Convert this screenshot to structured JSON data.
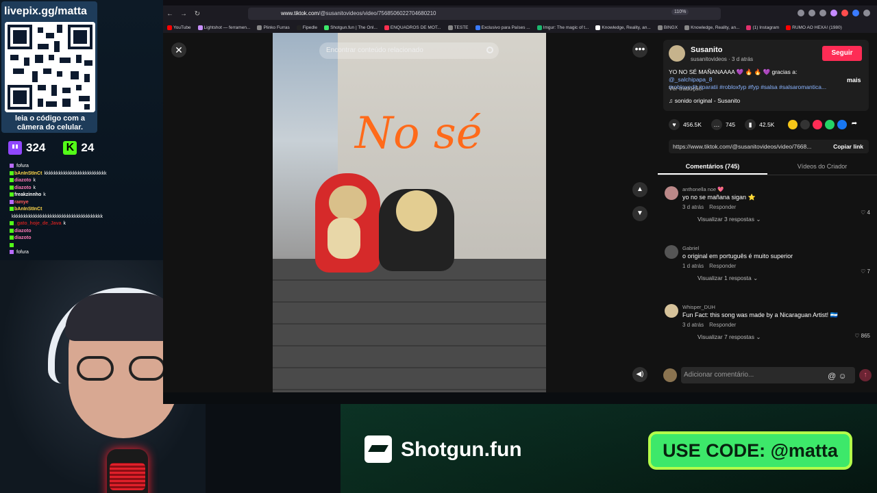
{
  "overlay": {
    "qr_title": "livepix.gg/matta",
    "qr_caption": "leia o código com a câmera do celular.",
    "twitch_count": "324",
    "kick_count": "24",
    "chat": [
      {
        "user": "",
        "msg": "fofura"
      },
      {
        "user": "bAnInStInCt",
        "msg": "kkkkkkkkkkkkkkkkkkkkkkkkkk"
      },
      {
        "user": "diazoto",
        "msg": "k"
      },
      {
        "user": "diazoto",
        "msg": "k"
      },
      {
        "user": "freakzinnho",
        "msg": "k"
      },
      {
        "user": "ramye",
        "msg": ""
      },
      {
        "user": "bAnInStInCt",
        "msg": ""
      },
      {
        "user": "",
        "msg": "kkkkkkkkkkkkkkkkkkkkkkkkkkkkkkkkkkkkkk"
      },
      {
        "user": "_gato_hoje_de_Java",
        "msg": "k"
      },
      {
        "user": "diazoto",
        "msg": ""
      },
      {
        "user": "diazoto",
        "msg": ""
      },
      {
        "user": "",
        "msg": ""
      },
      {
        "user": "",
        "msg": "fofura"
      }
    ]
  },
  "browser": {
    "url_host": "www.tiktok.com",
    "url_path": "/@susanitovideos/video/7568506022704680210",
    "zoom": "110%",
    "bookmarks": [
      "YouTube",
      "Lightshot — ferramen...",
      "Plinko Furras",
      "Fipedle",
      "Shotgun.fun | The Onl...",
      "ENQUADROS DE MOT...",
      "TESTE",
      "Exclusivo para Países ...",
      "Imgur: The magic of t...",
      "Knowledge, Reality, an...",
      "BINGX",
      "Knowledge, Reality, an...",
      "(1) Instagram",
      "RUMO AO HEXA! (1980)"
    ]
  },
  "tiktok": {
    "search_placeholder": "Encontrar conteúdo relacionado",
    "video_text": "No sé",
    "author": "Susanito",
    "author_meta": "susanitovideos · 3 d atrás",
    "follow": "Seguir",
    "caption": "YO NO SÉ MAÑANAAAA 💜 🔥 🔥 💜 gracias a: ",
    "mention": "@_salchipapa_8",
    "hashtags": "#robloxedit #paratii #robloxfyp #fyp #salsa #salsaromantica...",
    "more": "mais",
    "translate": "Ver tradução",
    "sound": "♫  sonido original - Susanito",
    "likes": "456.5K",
    "comments_count": "745",
    "saves": "42.5K",
    "link": "https://www.tiktok.com/@susanitovideos/video/7668...",
    "copy_link": "Copiar link",
    "tab_comments": "Comentários (745)",
    "tab_creator": "Vídeos do Criador",
    "comments": [
      {
        "user": "anthonella noe 💖",
        "text": "yo no se mañana sigan ⭐",
        "time": "3 d atrás",
        "reply": "Responder",
        "likes": "♡ 4",
        "replies": "Visualizar 3 respostas ⌄"
      },
      {
        "user": "Gabriel",
        "text": "o original em português é muito superior",
        "time": "1 d atrás",
        "reply": "Responder",
        "likes": "♡ 7",
        "replies": "Visualizar 1 resposta ⌄"
      },
      {
        "user": "Whisper_DUH",
        "text": "Fun Fact: this song was made by a Nicaraguan Artist! 🇳🇮",
        "time": "3 d atrás",
        "reply": "Responder",
        "likes": "♡ 865",
        "replies": "Visualizar 7 respostas ⌄"
      }
    ],
    "comment_placeholder": "Adicionar comentário..."
  },
  "banner": {
    "brand": "Shotgun.fun",
    "code": "USE CODE: @matta"
  }
}
